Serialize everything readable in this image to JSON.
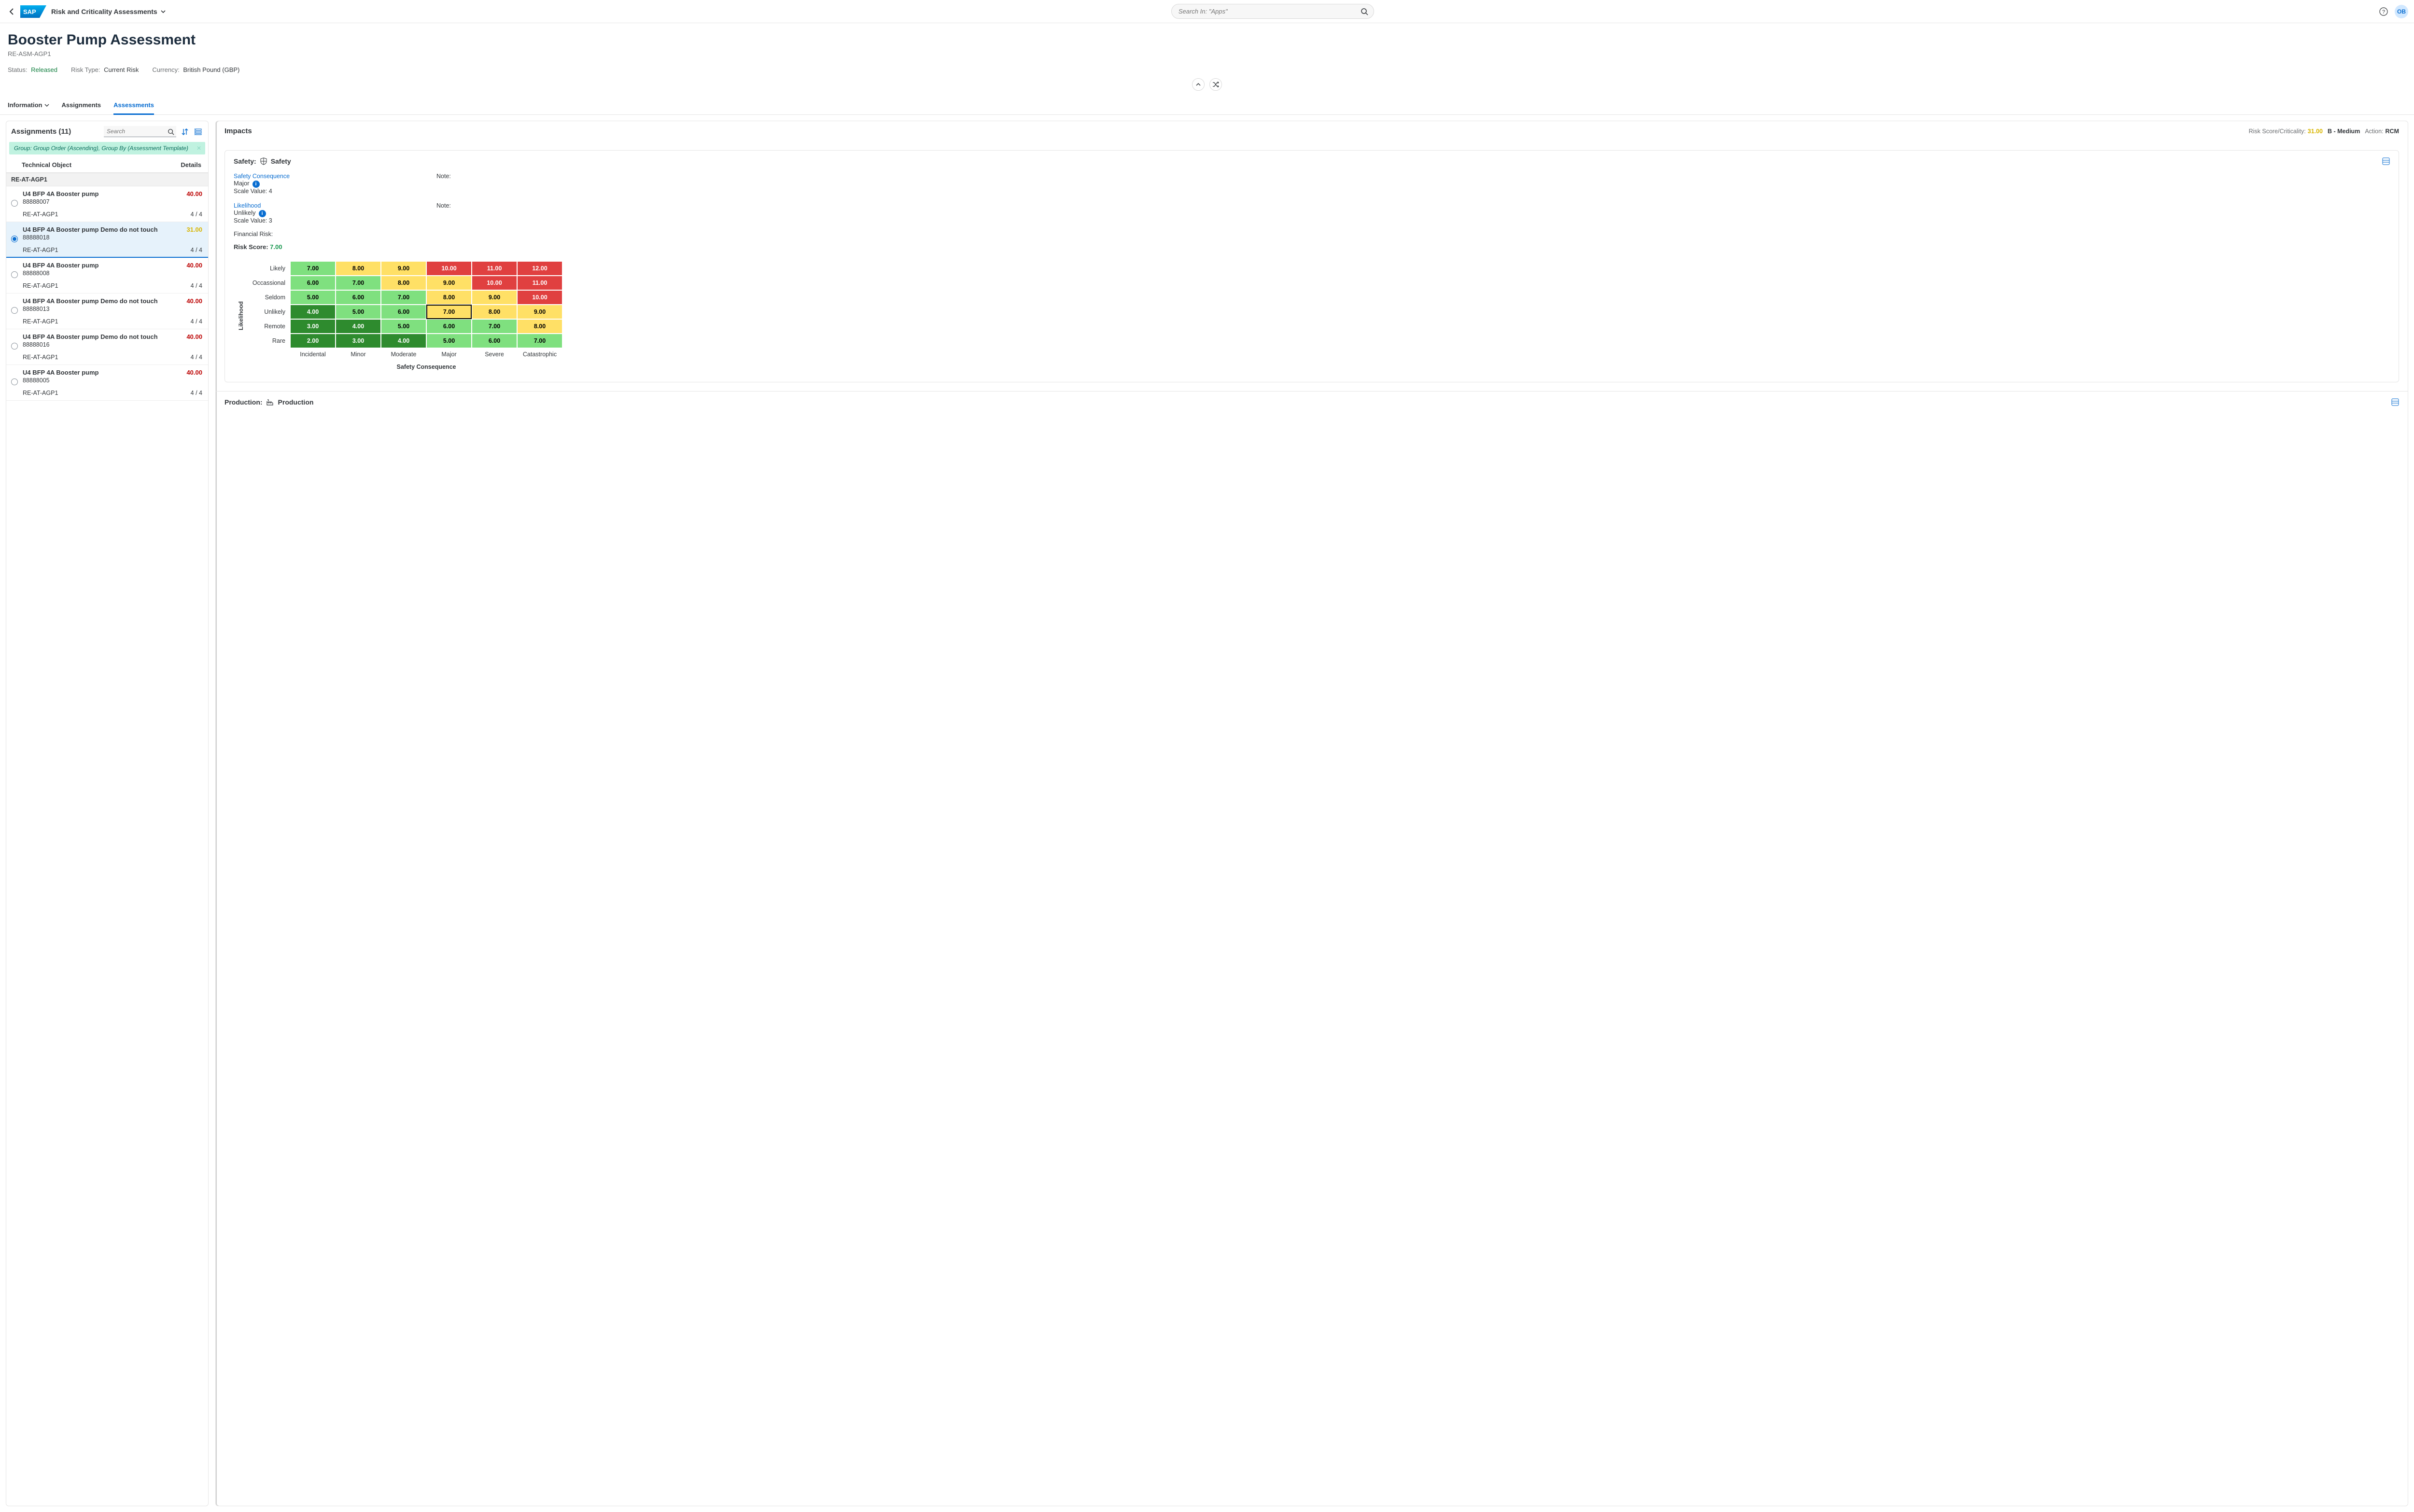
{
  "header": {
    "app_title": "Risk and Criticality Assessments",
    "search_placeholder": "Search In: \"Apps\"",
    "avatar_initials": "OB"
  },
  "object": {
    "title": "Booster Pump Assessment",
    "subtitle": "RE-ASM-AGP1",
    "status_label": "Status:",
    "status_value": "Released",
    "risktype_label": "Risk Type:",
    "risktype_value": "Current Risk",
    "currency_label": "Currency:",
    "currency_value": "British Pound (GBP)"
  },
  "tabs": {
    "information": "Information",
    "assignments": "Assignments",
    "assessments": "Assessments"
  },
  "assignments": {
    "title": "Assignments (11)",
    "search_placeholder": "Search",
    "group_pill": "Group: Group Order (Ascending), Group By (Assessment Template)",
    "col_object": "Technical Object",
    "col_details": "Details",
    "group_name": "RE-AT-AGP1",
    "items": [
      {
        "name": "U4 BFP 4A Booster pump",
        "id": "88888007",
        "score": "40.00",
        "score_class": "red",
        "sub": "RE-AT-AGP1",
        "detail": "4 / 4",
        "selected": false
      },
      {
        "name": "U4 BFP 4A Booster pump Demo do not touch",
        "id": "88888018",
        "score": "31.00",
        "score_class": "yellow",
        "sub": "RE-AT-AGP1",
        "detail": "4 / 4",
        "selected": true
      },
      {
        "name": "U4 BFP 4A Booster pump",
        "id": "88888008",
        "score": "40.00",
        "score_class": "red",
        "sub": "RE-AT-AGP1",
        "detail": "4 / 4",
        "selected": false
      },
      {
        "name": "U4 BFP 4A Booster pump Demo do not touch",
        "id": "88888013",
        "score": "40.00",
        "score_class": "red",
        "sub": "RE-AT-AGP1",
        "detail": "4 / 4",
        "selected": false
      },
      {
        "name": "U4 BFP 4A Booster pump Demo do not touch",
        "id": "88888016",
        "score": "40.00",
        "score_class": "red",
        "sub": "RE-AT-AGP1",
        "detail": "4 / 4",
        "selected": false
      },
      {
        "name": "U4 BFP 4A Booster pump",
        "id": "88888005",
        "score": "40.00",
        "score_class": "red",
        "sub": "RE-AT-AGP1",
        "detail": "4 / 4",
        "selected": false
      }
    ]
  },
  "impacts": {
    "title": "Impacts",
    "rs_label": "Risk Score/Criticality:",
    "rs_value": "31.00",
    "crit_value": "B - Medium",
    "action_label": "Action:",
    "action_value": "RCM"
  },
  "safety": {
    "section_label": "Safety:",
    "section_name": "Safety",
    "cons_label": "Safety Consequence",
    "cons_value": "Major",
    "cons_scale": "Scale Value: 4",
    "like_label": "Likelihood",
    "like_value": "Unlikely",
    "like_scale": "Scale Value: 3",
    "note_label": "Note:",
    "fin_label": "Financial Risk:",
    "score_label": "Risk Score:",
    "score_value": "7.00"
  },
  "chart_data": {
    "type": "heatmap",
    "title": "",
    "xlabel": "Safety Consequence",
    "ylabel": "Likelihood",
    "x_categories": [
      "Incidental",
      "Minor",
      "Moderate",
      "Major",
      "Severe",
      "Catastrophic"
    ],
    "y_categories": [
      "Likely",
      "Occassional",
      "Seldom",
      "Unlikely",
      "Remote",
      "Rare"
    ],
    "values": [
      [
        7.0,
        8.0,
        9.0,
        10.0,
        11.0,
        12.0
      ],
      [
        6.0,
        7.0,
        8.0,
        9.0,
        10.0,
        11.0
      ],
      [
        5.0,
        6.0,
        7.0,
        8.0,
        9.0,
        10.0
      ],
      [
        4.0,
        5.0,
        6.0,
        7.0,
        8.0,
        9.0
      ],
      [
        3.0,
        4.0,
        5.0,
        6.0,
        7.0,
        8.0
      ],
      [
        2.0,
        3.0,
        4.0,
        5.0,
        6.0,
        7.0
      ]
    ],
    "colors": [
      [
        "#7fe07f",
        "#ffe066",
        "#ffe066",
        "#e04040",
        "#e04040",
        "#e04040"
      ],
      [
        "#7fe07f",
        "#7fe07f",
        "#ffe066",
        "#ffe066",
        "#e04040",
        "#e04040"
      ],
      [
        "#7fe07f",
        "#7fe07f",
        "#7fe07f",
        "#ffe066",
        "#ffe066",
        "#e04040"
      ],
      [
        "#2e8b2e",
        "#7fe07f",
        "#7fe07f",
        "#ffe066",
        "#ffe066",
        "#ffe066"
      ],
      [
        "#2e8b2e",
        "#2e8b2e",
        "#7fe07f",
        "#7fe07f",
        "#7fe07f",
        "#ffe066"
      ],
      [
        "#2e8b2e",
        "#2e8b2e",
        "#2e8b2e",
        "#7fe07f",
        "#7fe07f",
        "#7fe07f"
      ]
    ],
    "text_colors": [
      [
        "#000",
        "#000",
        "#000",
        "#fff",
        "#fff",
        "#fff"
      ],
      [
        "#000",
        "#000",
        "#000",
        "#000",
        "#fff",
        "#fff"
      ],
      [
        "#000",
        "#000",
        "#000",
        "#000",
        "#000",
        "#fff"
      ],
      [
        "#fff",
        "#000",
        "#000",
        "#000",
        "#000",
        "#000"
      ],
      [
        "#fff",
        "#fff",
        "#000",
        "#000",
        "#000",
        "#000"
      ],
      [
        "#fff",
        "#fff",
        "#fff",
        "#000",
        "#000",
        "#000"
      ]
    ],
    "highlight": {
      "row": 3,
      "col": 3
    }
  },
  "production": {
    "section_label": "Production:",
    "section_name": "Production"
  }
}
